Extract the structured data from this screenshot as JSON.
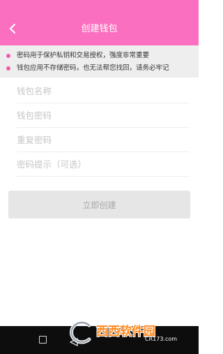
{
  "header": {
    "title": "创建钱包",
    "back_icon": "chevron-left-icon",
    "background_color": "#fa6fbf"
  },
  "notice": {
    "items": [
      "密码用于保护私钥和交易授权，强度非常重要",
      "钱包应用不存储密码，也无法帮您找回，请务必牢记"
    ],
    "dot_color": "#f05aaa"
  },
  "form": {
    "name_placeholder": "钱包名称",
    "password_placeholder": "钱包密码",
    "repeat_placeholder": "重复密码",
    "hint_placeholder": "密码提示（可选）"
  },
  "actions": {
    "create_label": "立即创建"
  },
  "navbar": {
    "icons": [
      "square-icon",
      "triangle-back-icon"
    ]
  },
  "watermark": {
    "main_text": "西西软件园",
    "sub_text": "CR173.com"
  }
}
